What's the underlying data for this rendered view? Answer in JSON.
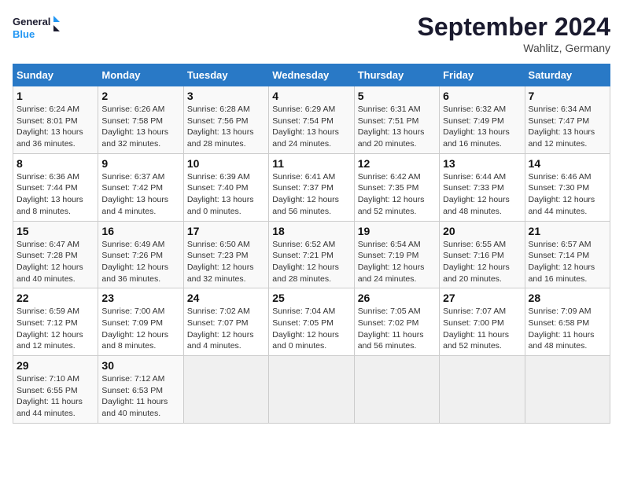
{
  "header": {
    "logo_line1": "General",
    "logo_line2": "Blue",
    "month": "September 2024",
    "location": "Wahlitz, Germany"
  },
  "weekdays": [
    "Sunday",
    "Monday",
    "Tuesday",
    "Wednesday",
    "Thursday",
    "Friday",
    "Saturday"
  ],
  "weeks": [
    [
      {
        "day": "1",
        "sunrise": "6:24 AM",
        "sunset": "8:01 PM",
        "daylight": "13 hours and 36 minutes."
      },
      {
        "day": "2",
        "sunrise": "6:26 AM",
        "sunset": "7:58 PM",
        "daylight": "13 hours and 32 minutes."
      },
      {
        "day": "3",
        "sunrise": "6:28 AM",
        "sunset": "7:56 PM",
        "daylight": "13 hours and 28 minutes."
      },
      {
        "day": "4",
        "sunrise": "6:29 AM",
        "sunset": "7:54 PM",
        "daylight": "13 hours and 24 minutes."
      },
      {
        "day": "5",
        "sunrise": "6:31 AM",
        "sunset": "7:51 PM",
        "daylight": "13 hours and 20 minutes."
      },
      {
        "day": "6",
        "sunrise": "6:32 AM",
        "sunset": "7:49 PM",
        "daylight": "13 hours and 16 minutes."
      },
      {
        "day": "7",
        "sunrise": "6:34 AM",
        "sunset": "7:47 PM",
        "daylight": "13 hours and 12 minutes."
      }
    ],
    [
      {
        "day": "8",
        "sunrise": "6:36 AM",
        "sunset": "7:44 PM",
        "daylight": "13 hours and 8 minutes."
      },
      {
        "day": "9",
        "sunrise": "6:37 AM",
        "sunset": "7:42 PM",
        "daylight": "13 hours and 4 minutes."
      },
      {
        "day": "10",
        "sunrise": "6:39 AM",
        "sunset": "7:40 PM",
        "daylight": "13 hours and 0 minutes."
      },
      {
        "day": "11",
        "sunrise": "6:41 AM",
        "sunset": "7:37 PM",
        "daylight": "12 hours and 56 minutes."
      },
      {
        "day": "12",
        "sunrise": "6:42 AM",
        "sunset": "7:35 PM",
        "daylight": "12 hours and 52 minutes."
      },
      {
        "day": "13",
        "sunrise": "6:44 AM",
        "sunset": "7:33 PM",
        "daylight": "12 hours and 48 minutes."
      },
      {
        "day": "14",
        "sunrise": "6:46 AM",
        "sunset": "7:30 PM",
        "daylight": "12 hours and 44 minutes."
      }
    ],
    [
      {
        "day": "15",
        "sunrise": "6:47 AM",
        "sunset": "7:28 PM",
        "daylight": "12 hours and 40 minutes."
      },
      {
        "day": "16",
        "sunrise": "6:49 AM",
        "sunset": "7:26 PM",
        "daylight": "12 hours and 36 minutes."
      },
      {
        "day": "17",
        "sunrise": "6:50 AM",
        "sunset": "7:23 PM",
        "daylight": "12 hours and 32 minutes."
      },
      {
        "day": "18",
        "sunrise": "6:52 AM",
        "sunset": "7:21 PM",
        "daylight": "12 hours and 28 minutes."
      },
      {
        "day": "19",
        "sunrise": "6:54 AM",
        "sunset": "7:19 PM",
        "daylight": "12 hours and 24 minutes."
      },
      {
        "day": "20",
        "sunrise": "6:55 AM",
        "sunset": "7:16 PM",
        "daylight": "12 hours and 20 minutes."
      },
      {
        "day": "21",
        "sunrise": "6:57 AM",
        "sunset": "7:14 PM",
        "daylight": "12 hours and 16 minutes."
      }
    ],
    [
      {
        "day": "22",
        "sunrise": "6:59 AM",
        "sunset": "7:12 PM",
        "daylight": "12 hours and 12 minutes."
      },
      {
        "day": "23",
        "sunrise": "7:00 AM",
        "sunset": "7:09 PM",
        "daylight": "12 hours and 8 minutes."
      },
      {
        "day": "24",
        "sunrise": "7:02 AM",
        "sunset": "7:07 PM",
        "daylight": "12 hours and 4 minutes."
      },
      {
        "day": "25",
        "sunrise": "7:04 AM",
        "sunset": "7:05 PM",
        "daylight": "12 hours and 0 minutes."
      },
      {
        "day": "26",
        "sunrise": "7:05 AM",
        "sunset": "7:02 PM",
        "daylight": "11 hours and 56 minutes."
      },
      {
        "day": "27",
        "sunrise": "7:07 AM",
        "sunset": "7:00 PM",
        "daylight": "11 hours and 52 minutes."
      },
      {
        "day": "28",
        "sunrise": "7:09 AM",
        "sunset": "6:58 PM",
        "daylight": "11 hours and 48 minutes."
      }
    ],
    [
      {
        "day": "29",
        "sunrise": "7:10 AM",
        "sunset": "6:55 PM",
        "daylight": "11 hours and 44 minutes."
      },
      {
        "day": "30",
        "sunrise": "7:12 AM",
        "sunset": "6:53 PM",
        "daylight": "11 hours and 40 minutes."
      },
      null,
      null,
      null,
      null,
      null
    ]
  ]
}
